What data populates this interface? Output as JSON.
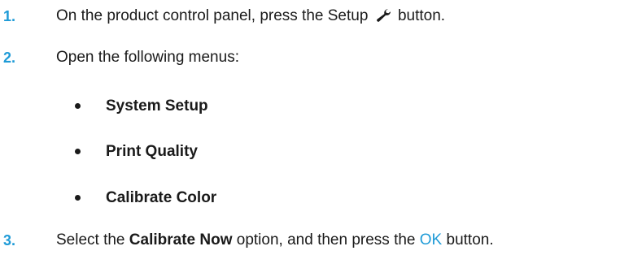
{
  "steps": [
    {
      "number": "1.",
      "text_before": "On the product control panel, press the Setup",
      "icon": "wrench-icon",
      "text_after": "button."
    },
    {
      "number": "2.",
      "text": "Open the following menus:",
      "menus": [
        "System Setup",
        "Print Quality",
        "Calibrate Color"
      ]
    },
    {
      "number": "3.",
      "text_before": "Select the",
      "option": "Calibrate Now",
      "text_middle": "option, and then press the",
      "button_name": "OK",
      "text_after": "button."
    }
  ],
  "colors": {
    "accent": "#1f9bd7",
    "text": "#1a1a1a"
  }
}
